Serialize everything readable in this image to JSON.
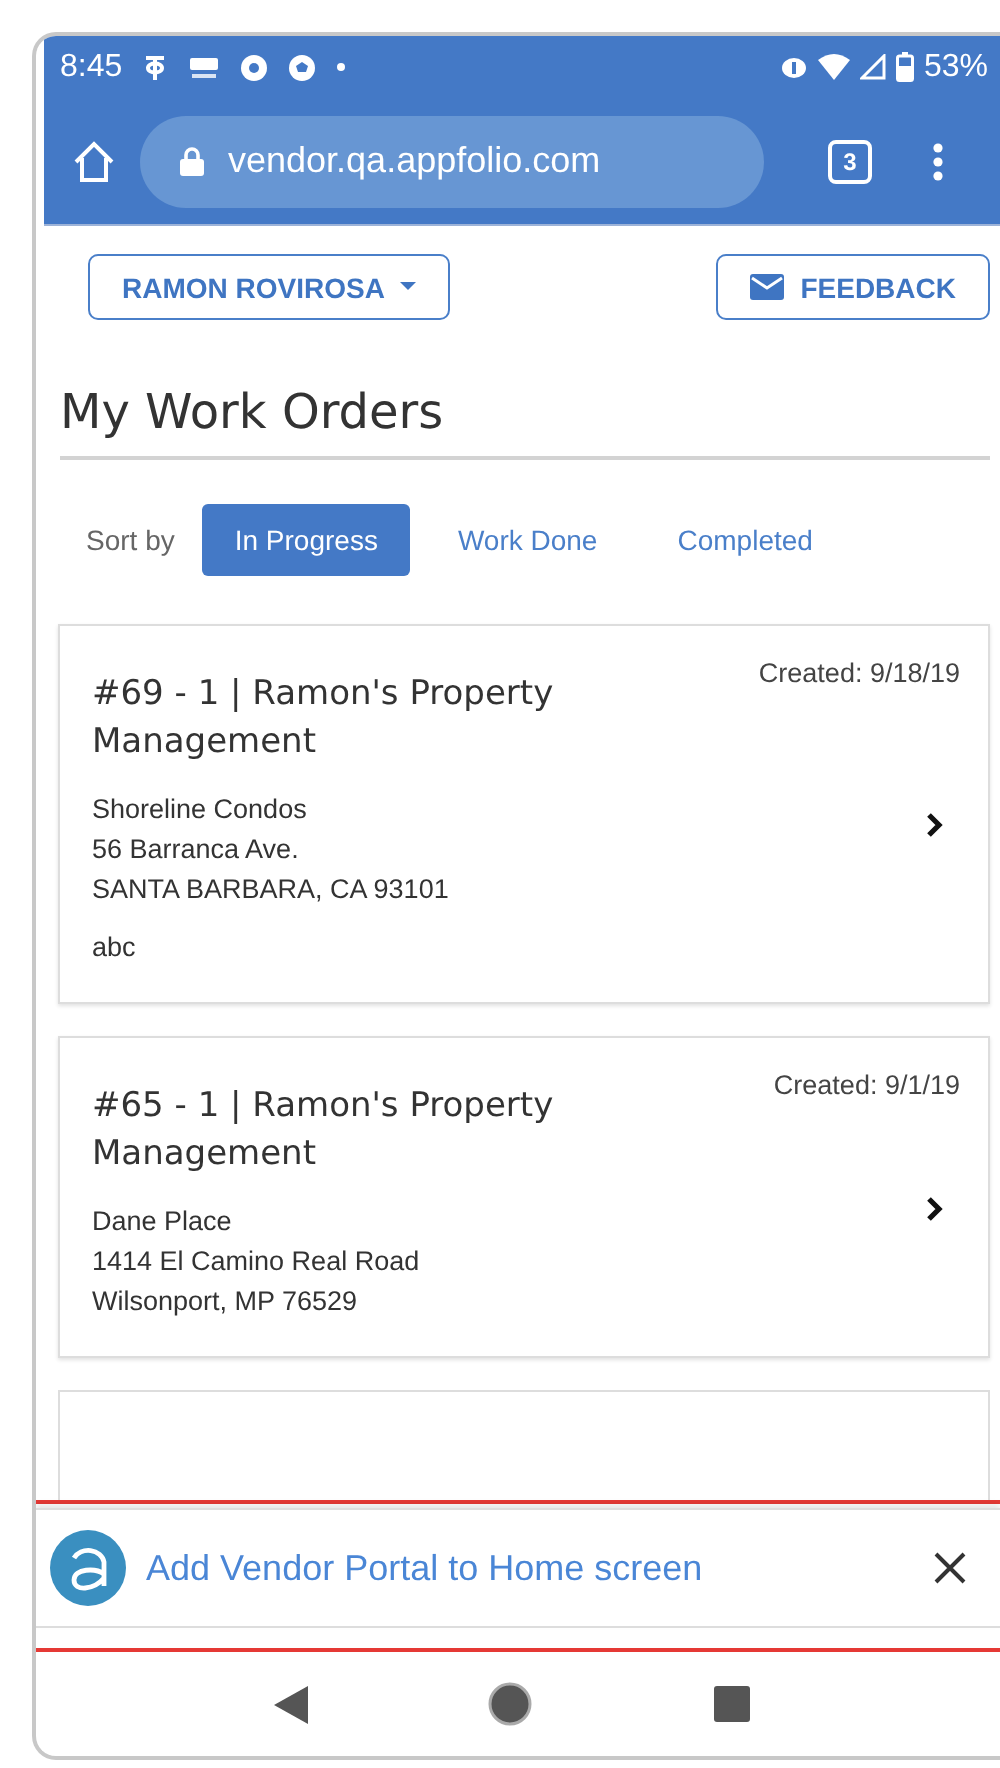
{
  "status_bar": {
    "time": "8:45",
    "battery": "53%"
  },
  "browser": {
    "url": "vendor.qa.appfolio.com",
    "tab_count": "3"
  },
  "header": {
    "user_menu": "RAMON ROVIROSA",
    "feedback": "FEEDBACK"
  },
  "title": "My Work Orders",
  "sort": {
    "label": "Sort by",
    "options": [
      {
        "label": "In Progress",
        "selected": true
      },
      {
        "label": "Work Done",
        "selected": false
      },
      {
        "label": "Completed",
        "selected": false
      }
    ]
  },
  "work_orders": [
    {
      "title": "#69 - 1 | Ramon's Property Management",
      "created": "Created: 9/18/19",
      "lines": [
        "Shoreline Condos",
        "56 Barranca Ave.",
        "SANTA BARBARA, CA 93101"
      ],
      "note": "abc"
    },
    {
      "title": "#65 - 1 | Ramon's Property Management",
      "created": "Created: 9/1/19",
      "lines": [
        "Dane Place",
        "1414 El Camino Real Road",
        "Wilsonport, MP 76529"
      ]
    }
  ],
  "install_banner": {
    "text": "Add Vendor Portal to Home screen"
  }
}
